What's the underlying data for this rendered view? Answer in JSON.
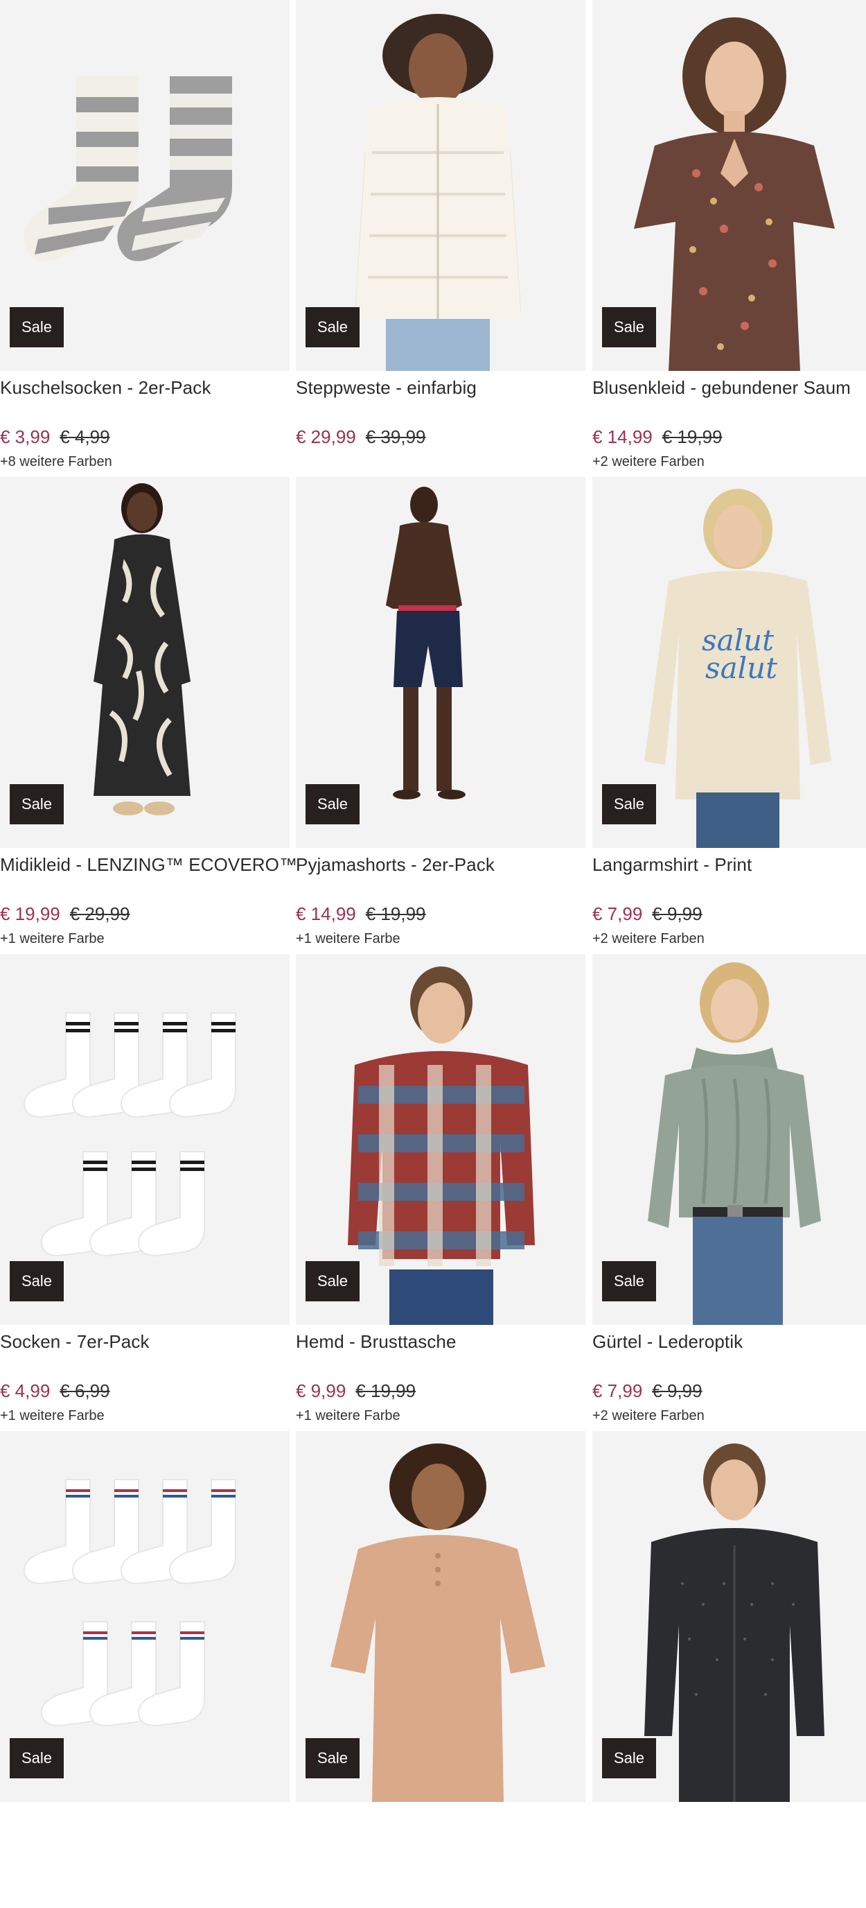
{
  "badge_label": "Sale",
  "colors": {
    "price_sale": "#a0314e",
    "badge_bg": "#26201f",
    "image_bg": "#f3f3f3"
  },
  "products": [
    {
      "name": "Kuschelsocken - 2er-Pack",
      "price": "€ 3,99",
      "old_price": "€ 4,99",
      "colors_text": "+8 weitere Farben",
      "image": "striped-cozy-socks-image"
    },
    {
      "name": "Steppweste - einfarbig",
      "price": "€ 29,99",
      "old_price": "€ 39,99",
      "colors_text": "",
      "image": "cream-puffer-vest-image"
    },
    {
      "name": "Blusenkleid - gebundener Saum",
      "price": "€ 14,99",
      "old_price": "€ 19,99",
      "colors_text": "+2 weitere Farben",
      "image": "floral-blouse-dress-image"
    },
    {
      "name": "Midikleid - LENZING™ ECOVERO™",
      "price": "€ 19,99",
      "old_price": "€ 29,99",
      "colors_text": "+1 weitere Farbe",
      "image": "patterned-midi-dress-image"
    },
    {
      "name": "Pyjamashorts - 2er-Pack",
      "price": "€ 14,99",
      "old_price": "€ 19,99",
      "colors_text": "+1 weitere Farbe",
      "image": "navy-pyjama-shorts-image"
    },
    {
      "name": "Langarmshirt - Print",
      "price": "€ 7,99",
      "old_price": "€ 9,99",
      "colors_text": "+2 weitere Farben",
      "image": "print-longsleeve-shirt-image"
    },
    {
      "name": "Socken - 7er-Pack",
      "price": "€ 4,99",
      "old_price": "€ 6,99",
      "colors_text": "+1 weitere Farbe",
      "image": "white-socks-black-stripes-image"
    },
    {
      "name": "Hemd - Brusttasche",
      "price": "€ 9,99",
      "old_price": "€ 19,99",
      "colors_text": "+1 weitere Farbe",
      "image": "checked-flannel-shirt-image"
    },
    {
      "name": "Gürtel - Lederoptik",
      "price": "€ 7,99",
      "old_price": "€ 9,99",
      "colors_text": "+2 weitere Farben",
      "image": "knit-sweater-belt-image"
    },
    {
      "name": "",
      "price": "",
      "old_price": "",
      "colors_text": "",
      "image": "white-socks-color-stripes-image"
    },
    {
      "name": "",
      "price": "",
      "old_price": "",
      "colors_text": "",
      "image": "beige-henley-top-image"
    },
    {
      "name": "",
      "price": "",
      "old_price": "",
      "colors_text": "",
      "image": "dark-dotted-shirt-image"
    }
  ]
}
